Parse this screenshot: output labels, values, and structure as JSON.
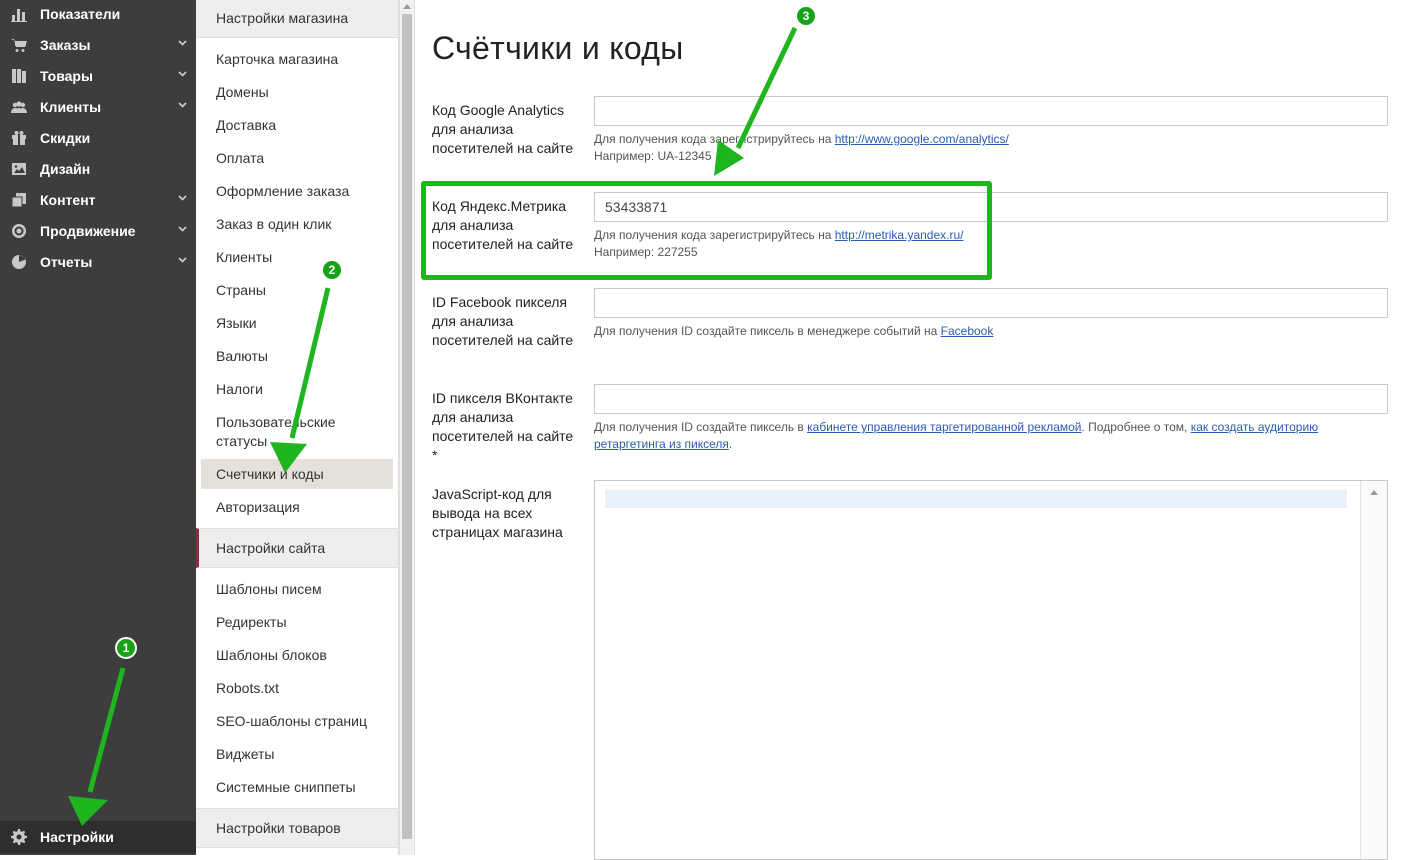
{
  "sidebar": {
    "items": [
      {
        "label": "Показатели",
        "icon": "chart-bar-icon",
        "has_children": false
      },
      {
        "label": "Заказы",
        "icon": "cart-icon",
        "has_children": true
      },
      {
        "label": "Товары",
        "icon": "products-icon",
        "has_children": true
      },
      {
        "label": "Клиенты",
        "icon": "users-icon",
        "has_children": true
      },
      {
        "label": "Скидки",
        "icon": "gift-icon",
        "has_children": false
      },
      {
        "label": "Дизайн",
        "icon": "image-icon",
        "has_children": false
      },
      {
        "label": "Контент",
        "icon": "pages-icon",
        "has_children": true
      },
      {
        "label": "Продвижение",
        "icon": "target-icon",
        "has_children": true
      },
      {
        "label": "Отчеты",
        "icon": "pie-chart-icon",
        "has_children": true
      }
    ],
    "settings": {
      "label": "Настройки",
      "icon": "gear-icon"
    }
  },
  "submenu": {
    "store_settings": {
      "title": "Настройки магазина",
      "items": [
        "Карточка магазина",
        "Домены",
        "Доставка",
        "Оплата",
        "Оформление заказа",
        "Заказ в один клик",
        "Клиенты",
        "Страны",
        "Языки",
        "Валюты",
        "Налоги",
        "Пользовательские статусы",
        "Счетчики и коды",
        "Авторизация"
      ],
      "active": "Счетчики и коды"
    },
    "site_settings": {
      "title": "Настройки сайта",
      "items": [
        "Шаблоны писем",
        "Редиректы",
        "Шаблоны блоков",
        "Robots.txt",
        "SEO-шаблоны страниц",
        "Виджеты",
        "Системные сниппеты"
      ]
    },
    "product_settings": {
      "title": "Настройки товаров"
    }
  },
  "main": {
    "title": "Счётчики и коды",
    "fields": [
      {
        "label": "Код Google Analytics для анализа посетителей на сайте",
        "value": "",
        "hint_text": "Для получения кода зарегистрируйтесь на ",
        "hint_link": "http://www.google.com/analytics/",
        "example": "Например: UA-12345"
      },
      {
        "label": "Код Яндекс.Метрика для анализа посетителей на сайте",
        "value": "53433871",
        "hint_text": "Для получения кода зарегистрируйтесь на ",
        "hint_link": "http://metrika.yandex.ru/",
        "example": "Например: 227255"
      },
      {
        "label": "ID Facebook пикселя для анализа посетителей на сайте",
        "value": "",
        "hint_text": "Для получения ID создайте пиксель в менеджере событий на ",
        "hint_link": "Facebook"
      },
      {
        "label": "ID пикселя ВКонтакте для анализа посетителей на сайте *",
        "value": "",
        "hint_text": "Для получения ID создайте пиксель в ",
        "hint_link": "кабинете управления таргетированной рекламой",
        "hint_text2": ". Подробнее о том, ",
        "hint_link2": "как создать аудиторию ретаргетинга из пикселя",
        "hint_text3": "."
      }
    ],
    "js_field": {
      "label": "JavaScript-код для вывода на всех страницах магазина"
    }
  },
  "annotations": {
    "badges": [
      "1",
      "2",
      "3"
    ],
    "color": "#1fb51f"
  }
}
